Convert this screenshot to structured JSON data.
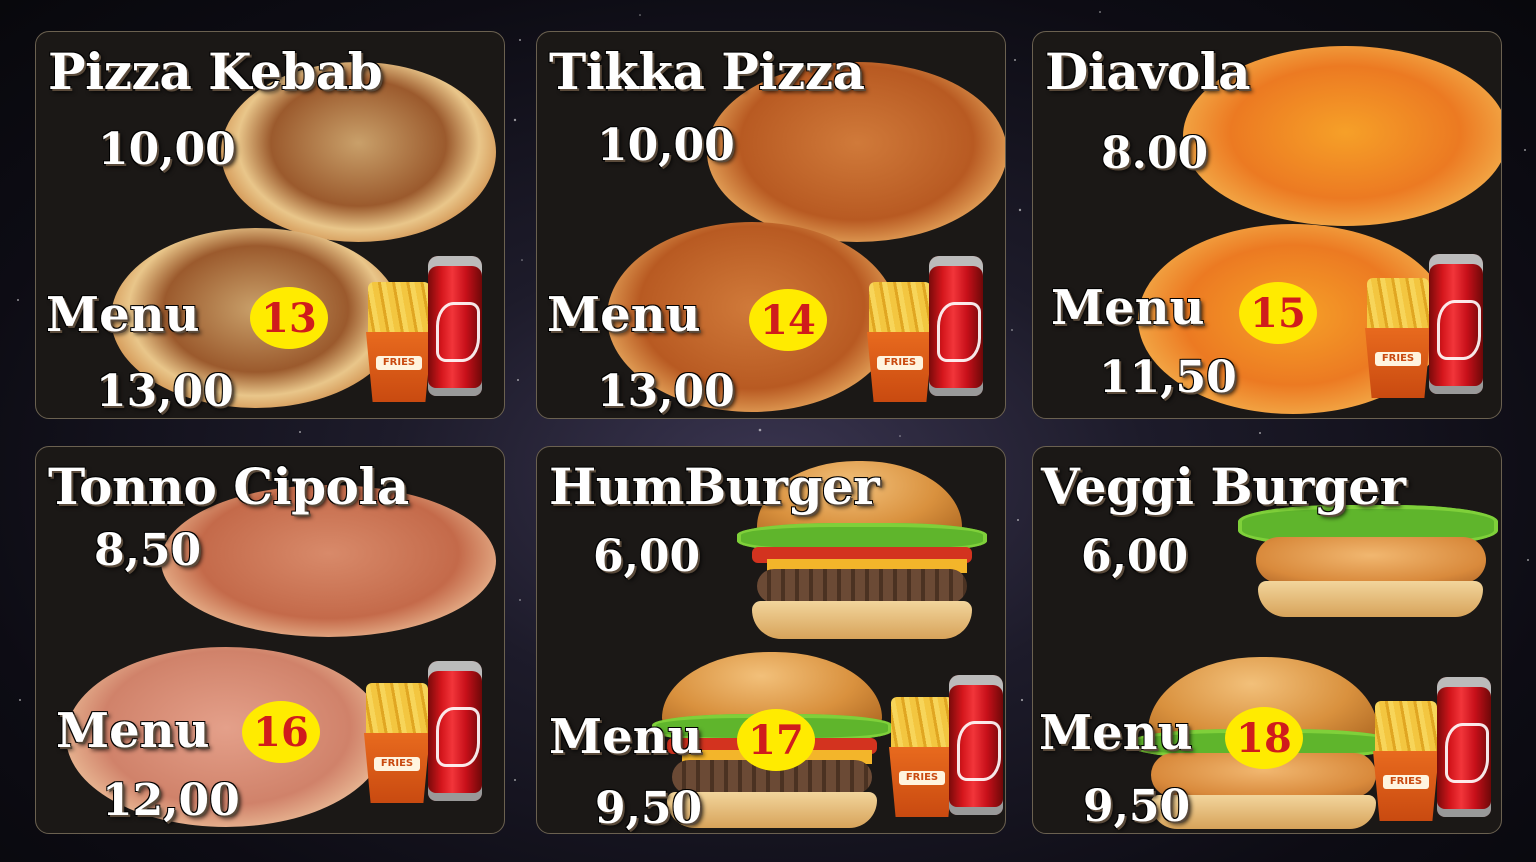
{
  "items": [
    {
      "name": "Pizza Kebab",
      "price": "10,00",
      "menu_label": "Menu",
      "menu_number": "13",
      "menu_price": "13,00"
    },
    {
      "name": "Tikka Pizza",
      "price": "10,00",
      "menu_label": "Menu",
      "menu_number": "14",
      "menu_price": "13,00"
    },
    {
      "name": "Diavola",
      "price": "8.00",
      "menu_label": "Menu",
      "menu_number": "15",
      "menu_price": "11,50"
    },
    {
      "name": "Tonno Cipola",
      "price": "8,50",
      "menu_label": "Menu",
      "menu_number": "16",
      "menu_price": "12,00"
    },
    {
      "name": "HumBurger",
      "price": "6,00",
      "menu_label": "Menu",
      "menu_number": "17",
      "menu_price": "9,50"
    },
    {
      "name": "Veggi Burger",
      "price": "6,00",
      "menu_label": "Menu",
      "menu_number": "18",
      "menu_price": "9,50"
    }
  ],
  "fries_label": "FRIES",
  "colors": {
    "badge_bg": "#ffeb00",
    "badge_text": "#d01c1c",
    "card_bg": "#1b1816",
    "text": "#ffffff"
  },
  "icons": [
    "pizza-image",
    "burger-image",
    "fries-icon",
    "cola-can-icon"
  ]
}
